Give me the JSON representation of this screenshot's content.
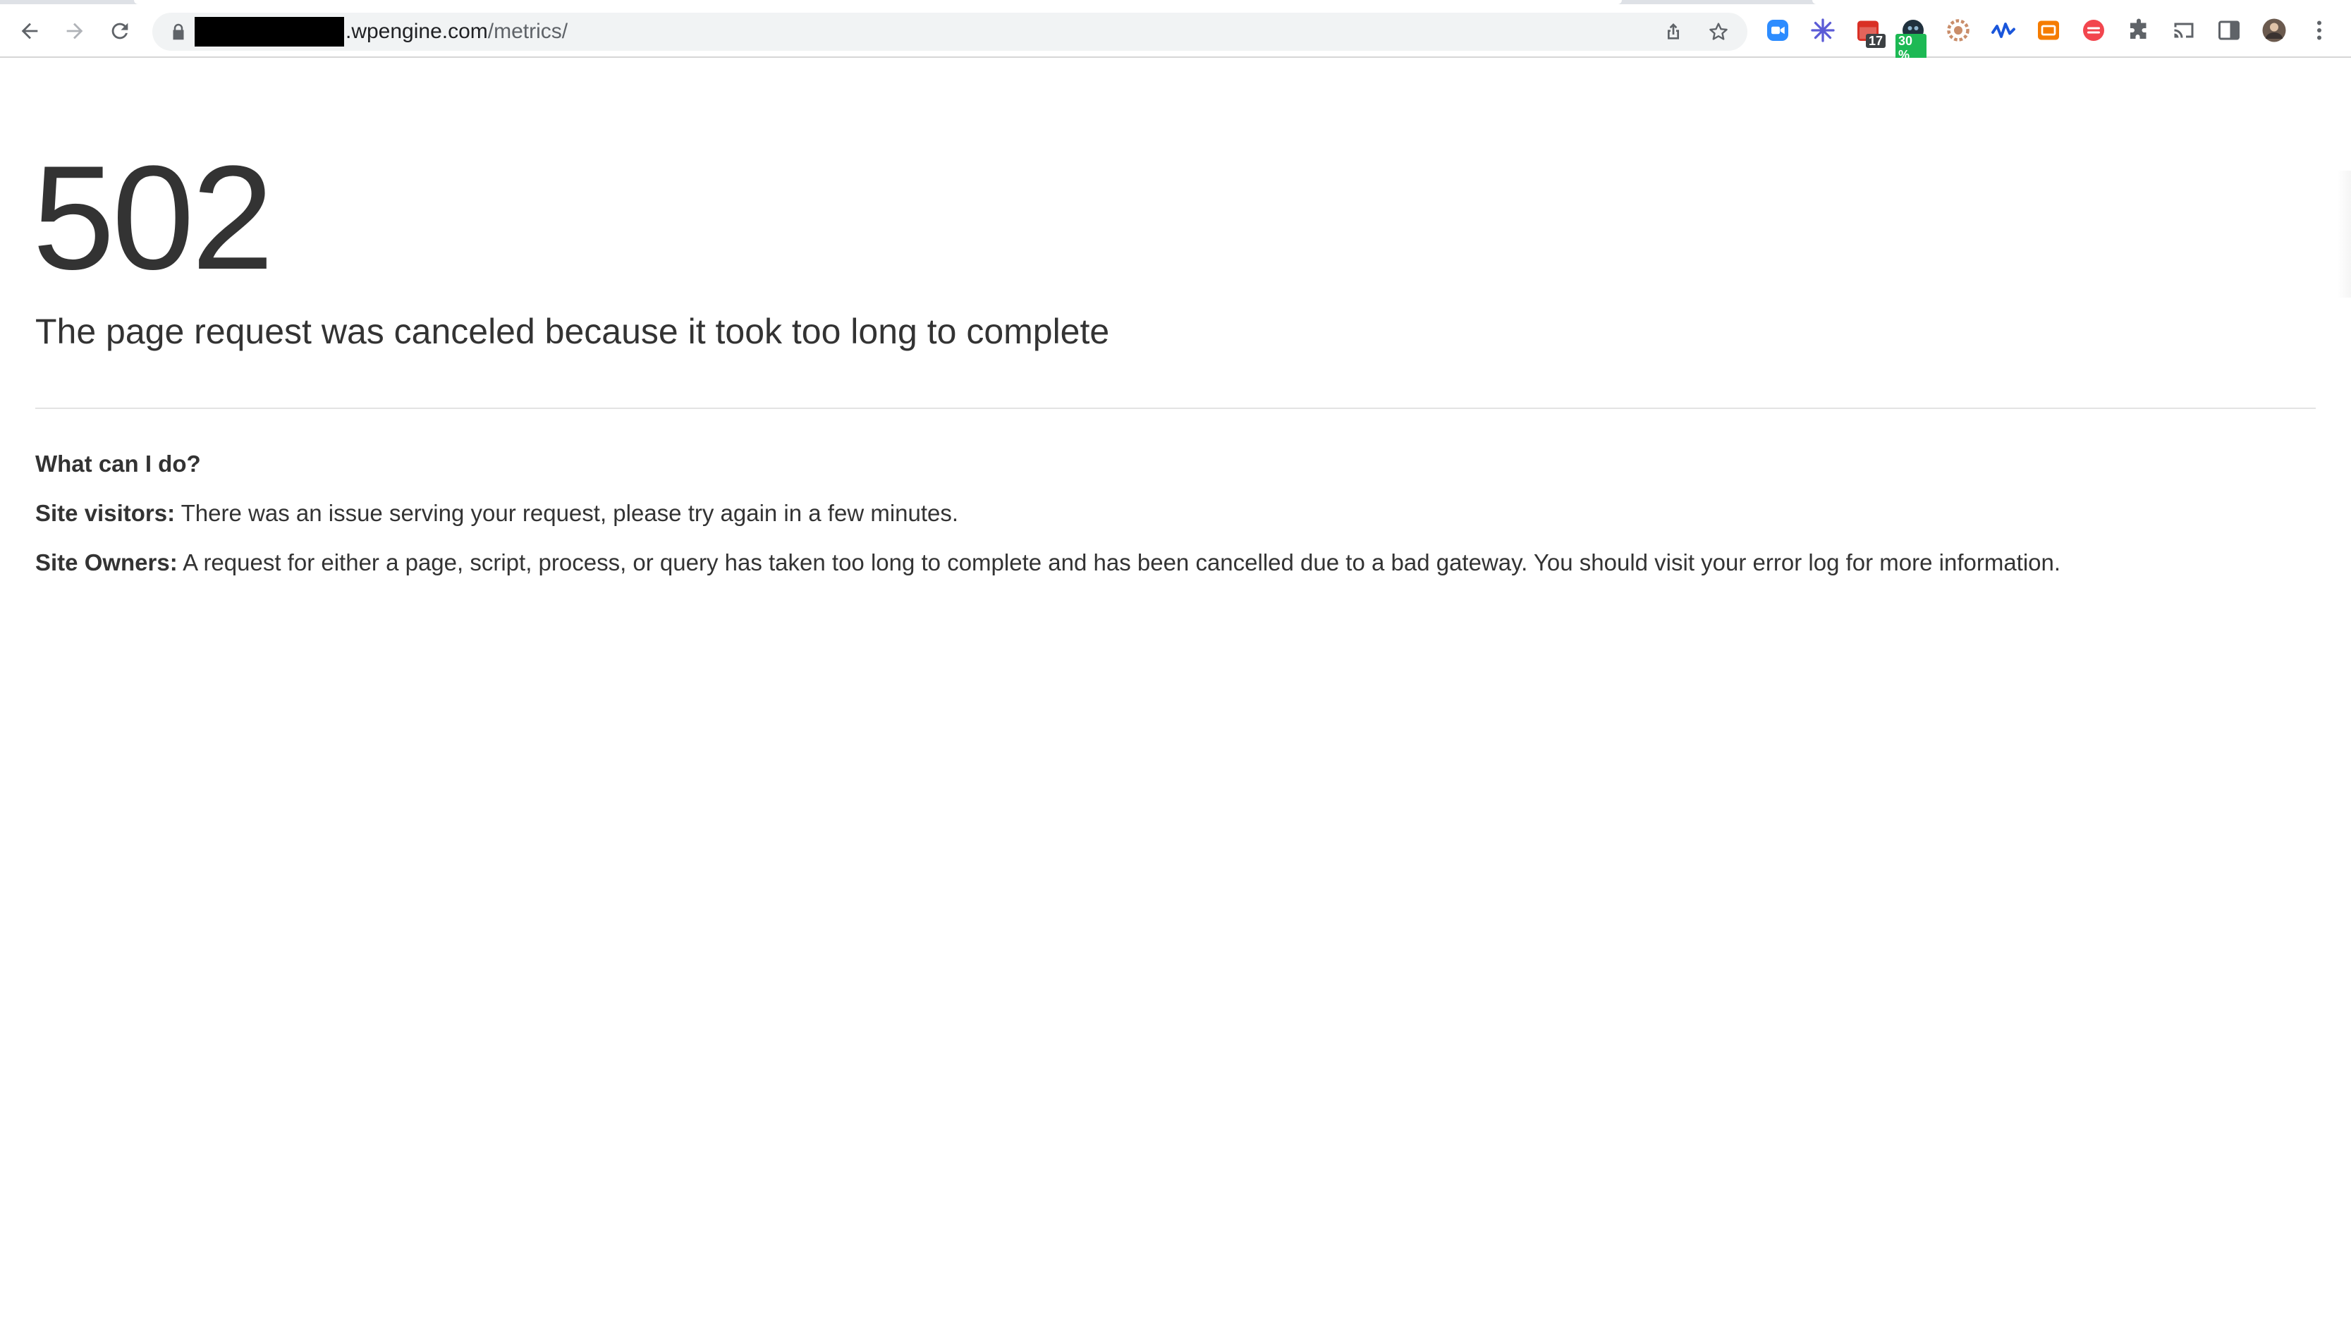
{
  "browser": {
    "url_host_visible": ".wpengine.com",
    "url_path": "/metrics/",
    "extensions": [
      {
        "icon": "zoom-icon",
        "color": "#2d8cff"
      },
      {
        "icon": "snowflake-icon",
        "color": "#5b5bd6"
      },
      {
        "icon": "calendar-icon",
        "color": "#d93025",
        "badge": "17"
      },
      {
        "icon": "dark-reader-icon",
        "color": "#20313e",
        "badge": "30 %"
      },
      {
        "icon": "gear-extension-icon",
        "color": "#c98d6a"
      },
      {
        "icon": "wave-icon",
        "color": "#1a56db"
      },
      {
        "icon": "screen-capture-icon",
        "color": "#f57c00"
      },
      {
        "icon": "red-circle-icon",
        "color": "#f2464e"
      },
      {
        "icon": "puzzle-icon",
        "color": "#5f6368"
      },
      {
        "icon": "cast-icon",
        "color": "#5f6368"
      },
      {
        "icon": "side-panel-icon",
        "color": "#5f6368"
      },
      {
        "icon": "profile-avatar",
        "color": "#6b5a4e"
      },
      {
        "icon": "more-menu-icon",
        "color": "#5f6368"
      }
    ]
  },
  "error": {
    "code": "502",
    "headline": "The page request was canceled because it took too long to complete",
    "subhead": "What can I do?",
    "visitors_label": "Site visitors:",
    "visitors_text": " There was an issue serving your request, please try again in a few minutes.",
    "owners_label": "Site Owners:",
    "owners_text": " A request for either a page, script, process, or query has taken too long to complete and has been cancelled due to a bad gateway. You should visit your error log for more information."
  }
}
